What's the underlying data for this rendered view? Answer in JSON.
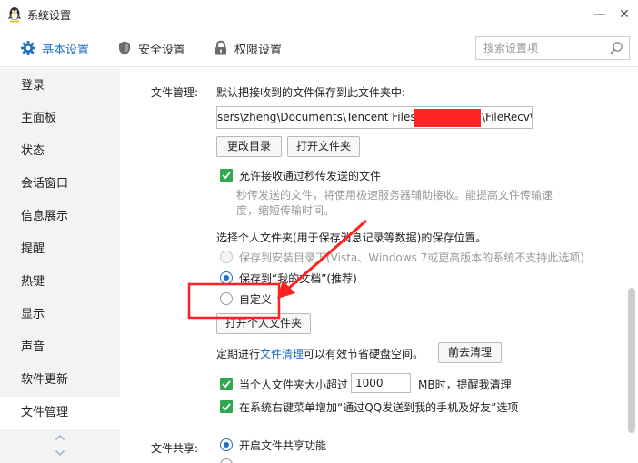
{
  "window": {
    "title": "系统设置",
    "minimize_glyph": "—",
    "close_glyph": "✕"
  },
  "tabs": [
    {
      "label": "基本设置",
      "icon": "gear-icon",
      "active": true
    },
    {
      "label": "安全设置",
      "icon": "shield-icon",
      "active": false
    },
    {
      "label": "权限设置",
      "icon": "lock-icon",
      "active": false
    }
  ],
  "search": {
    "placeholder": "搜索设置项"
  },
  "sidebar": {
    "items": [
      {
        "label": "登录"
      },
      {
        "label": "主面板"
      },
      {
        "label": "状态"
      },
      {
        "label": "会话窗口"
      },
      {
        "label": "信息展示"
      },
      {
        "label": "提醒"
      },
      {
        "label": "热键"
      },
      {
        "label": "显示"
      },
      {
        "label": "声音"
      },
      {
        "label": "软件更新"
      },
      {
        "label": "文件管理",
        "active": true
      }
    ]
  },
  "file_management": {
    "section_label": "文件管理:",
    "save_to_label": "默认把接收到的文件保存到此文件夹中:",
    "path_prefix": "sers\\zheng\\Documents\\Tencent Files\\",
    "path_suffix": "\\FileRecv\\",
    "change_dir_button": "更改目录",
    "open_folder_button": "打开文件夹",
    "allow_transfer_label": "允许接收通过秒传发送的文件",
    "allow_transfer_checked": true,
    "allow_transfer_hint_line1": "秒传发送的文件，将使用极速服务器辅助接收。能提高文件传输速",
    "allow_transfer_hint_line2": "度，缩短传输时间。",
    "personal_folder_label": "选择个人文件夹(用于保存消息记录等数据)的保存位置。",
    "options": [
      {
        "label": "保存到安装目录下(Vista、Windows 7或更高版本的系统不支持此选项)",
        "state": "disabled"
      },
      {
        "label": "保存到“我的文档”(推荐)",
        "state": "selected"
      },
      {
        "label": "自定义",
        "state": "unselected"
      }
    ],
    "open_personal_button": "打开个人文件夹",
    "cleanup_prefix": "定期进行",
    "cleanup_link": "文件清理",
    "cleanup_suffix": "可以有效节省硬盘空间。",
    "cleanup_button": "前去清理",
    "size_limit_prefix": "当个人文件夹大小超过",
    "size_limit_value": "1000",
    "size_limit_suffix": "MB时，提醒我清理",
    "size_limit_checked": true,
    "context_menu_label": "在系统右键菜单增加“通过QQ发送到我的手机及好友”选项",
    "context_menu_checked": true
  },
  "file_sharing": {
    "section_label": "文件共享:",
    "enable_label": "开启文件共享功能",
    "enable_selected": true
  },
  "colors": {
    "accent": "#1e6fc8",
    "check_green": "#2ea94f",
    "annotation_red": "#ff2020",
    "redaction_red": "#ff2424"
  }
}
